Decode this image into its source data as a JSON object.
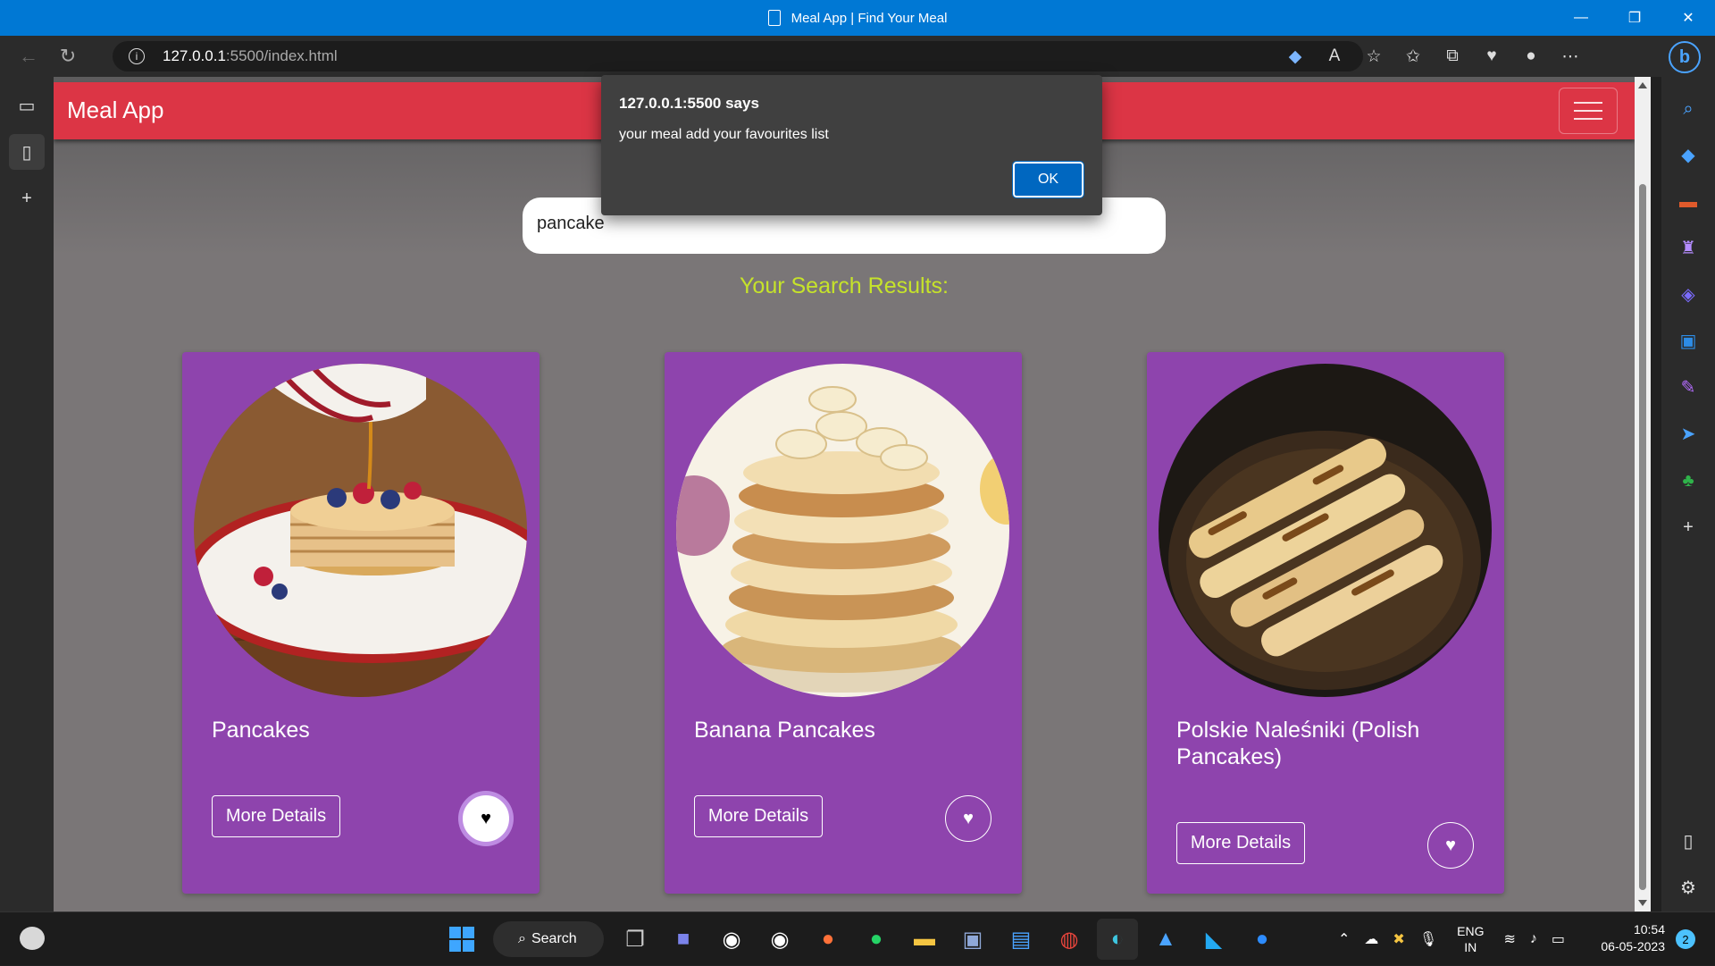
{
  "window": {
    "title": "Meal App | Find Your Meal"
  },
  "browser": {
    "url_host": "127.0.0.1",
    "url_path": ":5500/index.html"
  },
  "app": {
    "brand": "Meal App",
    "search_value": "pancake",
    "results_title": "Your Search Results:",
    "accent_color": "#dc3545",
    "card_color": "#8e44ad",
    "results_color": "#c6e32a",
    "cards": [
      {
        "name": "Pancakes",
        "button": "More Details",
        "favourited": true
      },
      {
        "name": "Banana Pancakes",
        "button": "More Details",
        "favourited": false
      },
      {
        "name": "Polskie Naleśniki (Polish Pancakes)",
        "button": "More Details",
        "favourited": false
      }
    ]
  },
  "dialog": {
    "title": "127.0.0.1:5500 says",
    "message": "your meal add your favourites list",
    "ok_label": "OK"
  },
  "taskbar": {
    "search_label": "Search",
    "language_top": "ENG",
    "language_bottom": "IN",
    "time": "10:54",
    "date": "06-05-2023",
    "notification_count": "2"
  }
}
